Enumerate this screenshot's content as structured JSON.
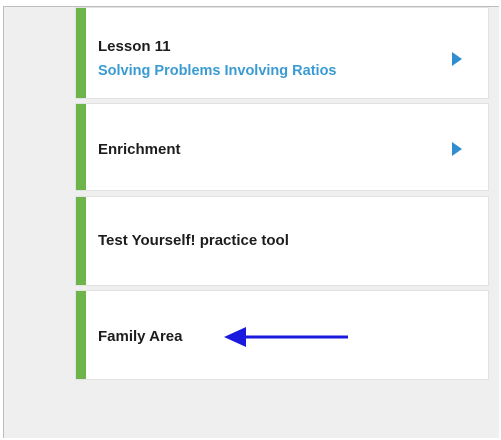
{
  "lessons": {
    "lesson11": {
      "title": "Lesson 11",
      "subtitle": "Solving Problems Involving Ratios"
    },
    "enrichment": {
      "title": "Enrichment"
    },
    "test_yourself": {
      "title": "Test Yourself! practice tool"
    },
    "family_area": {
      "title": "Family Area"
    }
  },
  "annotation": {
    "arrow_color": "#1a1adf",
    "arrow_direction": "left"
  },
  "colors": {
    "accent_green": "#6db54a",
    "link_blue": "#3a9bd2",
    "chevron_blue": "#2f8ed0"
  },
  "icons": {
    "expand": "chevron-right-icon"
  }
}
